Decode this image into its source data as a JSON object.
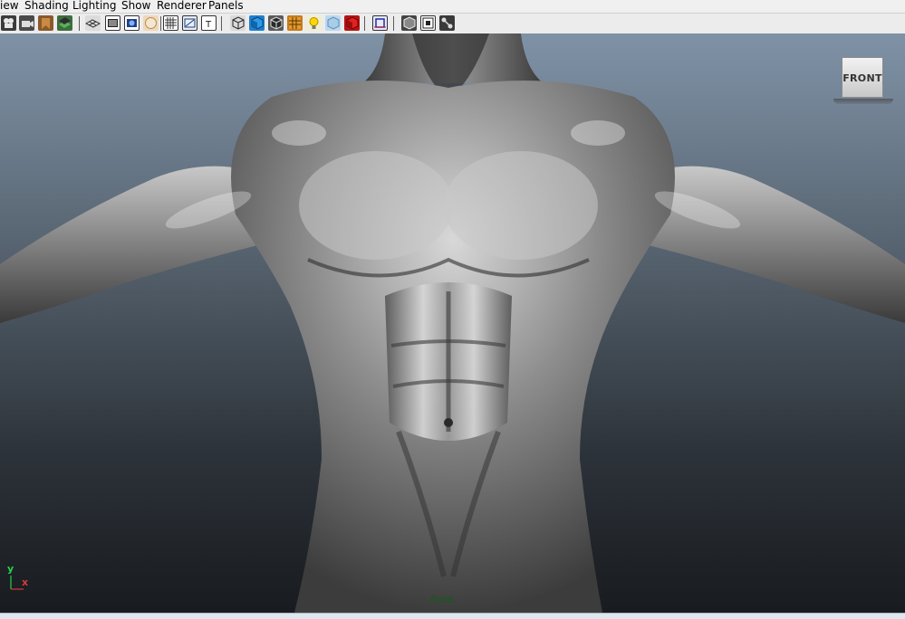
{
  "menu": {
    "items": [
      {
        "label": "iew"
      },
      {
        "label": "Shading"
      },
      {
        "label": "Lighting"
      },
      {
        "label": "Show"
      },
      {
        "label": "Renderer"
      },
      {
        "label": "Panels"
      }
    ]
  },
  "toolbar": {
    "buttons": [
      {
        "icon": "select-camera-icon"
      },
      {
        "icon": "camera-attributes-icon"
      },
      {
        "icon": "bookmark-icon"
      },
      {
        "icon": "image-plane-icon"
      },
      {
        "icon": "grid-icon"
      },
      {
        "icon": "film-gate-icon"
      },
      {
        "icon": "resolution-gate-icon"
      },
      {
        "icon": "gate-mask-icon"
      },
      {
        "icon": "field-chart-icon"
      },
      {
        "icon": "safe-action-icon"
      },
      {
        "icon": "safe-title-icon"
      },
      {
        "icon": "wireframe-icon"
      },
      {
        "icon": "smooth-shade-icon"
      },
      {
        "icon": "wireframe-on-shaded-icon"
      },
      {
        "icon": "textured-icon"
      },
      {
        "icon": "use-all-lights-icon"
      },
      {
        "icon": "shadows-icon"
      },
      {
        "icon": "xray-icon"
      },
      {
        "icon": "isolate-select-icon"
      },
      {
        "icon": "xray-active-icon"
      },
      {
        "icon": "xray-joints-icon"
      },
      {
        "icon": "texture-placement-icon"
      }
    ]
  },
  "viewport": {
    "camera_label": "front",
    "view_cube_label": "FRONT",
    "axis_y_label": "y",
    "axis_x_label": "x"
  },
  "colors": {
    "bg_top": "#7f92a6",
    "bg_bottom": "#181b1f",
    "camera_label": "#0e5e12",
    "axis_y": "#22d24c",
    "axis_x": "#d63a3a"
  }
}
